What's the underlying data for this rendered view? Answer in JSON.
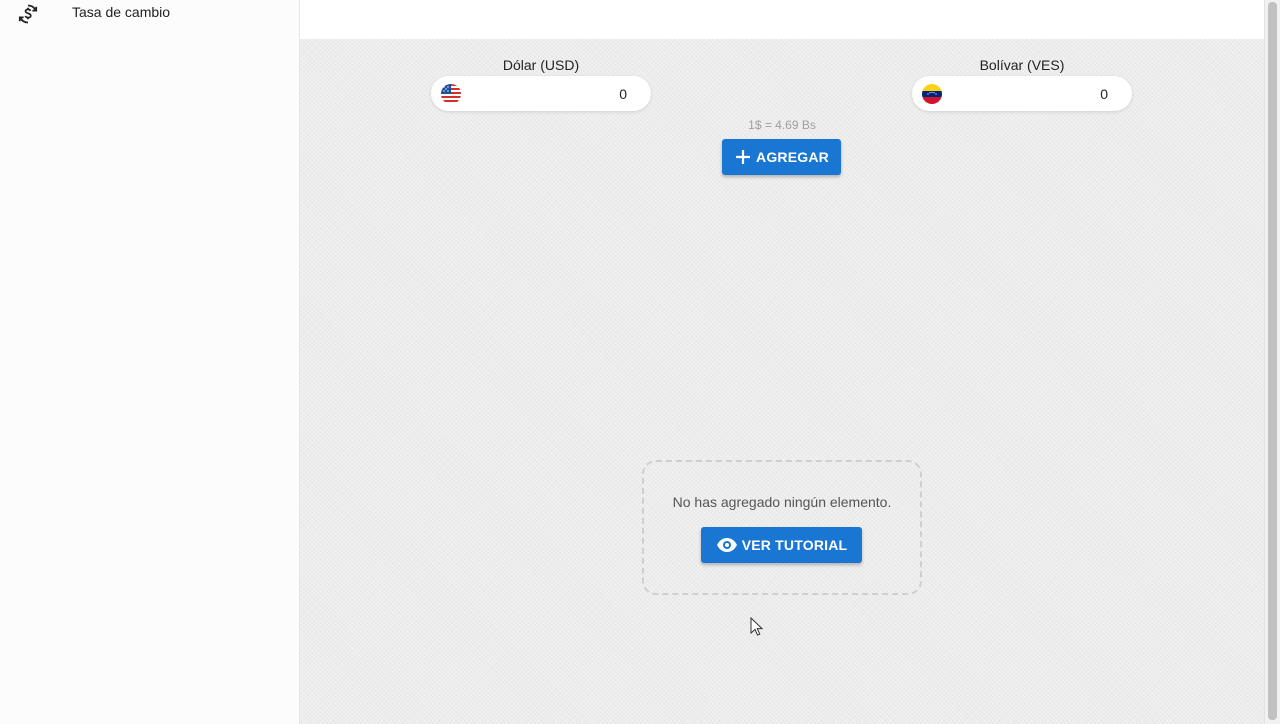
{
  "sidebar": {
    "items": [
      {
        "label": "Tasa de cambio",
        "icon": "currency-exchange-icon"
      }
    ]
  },
  "converter": {
    "from": {
      "label": "Dólar (USD)",
      "value": "0",
      "flag": "us-flag-icon"
    },
    "to": {
      "label": "Bolívar (VES)",
      "value": "0",
      "flag": "venezuela-flag-icon"
    },
    "rate_text": "1$ = 4.69 Bs",
    "add_button": {
      "label": "AGREGAR",
      "icon": "plus-icon"
    }
  },
  "empty_state": {
    "message": "No has agregado ningún elemento.",
    "tutorial_button": {
      "label": "VER TUTORIAL",
      "icon": "eye-icon"
    }
  },
  "colors": {
    "primary": "#1976d2",
    "background": "#ececec",
    "sidebar": "#fcfcfc"
  }
}
